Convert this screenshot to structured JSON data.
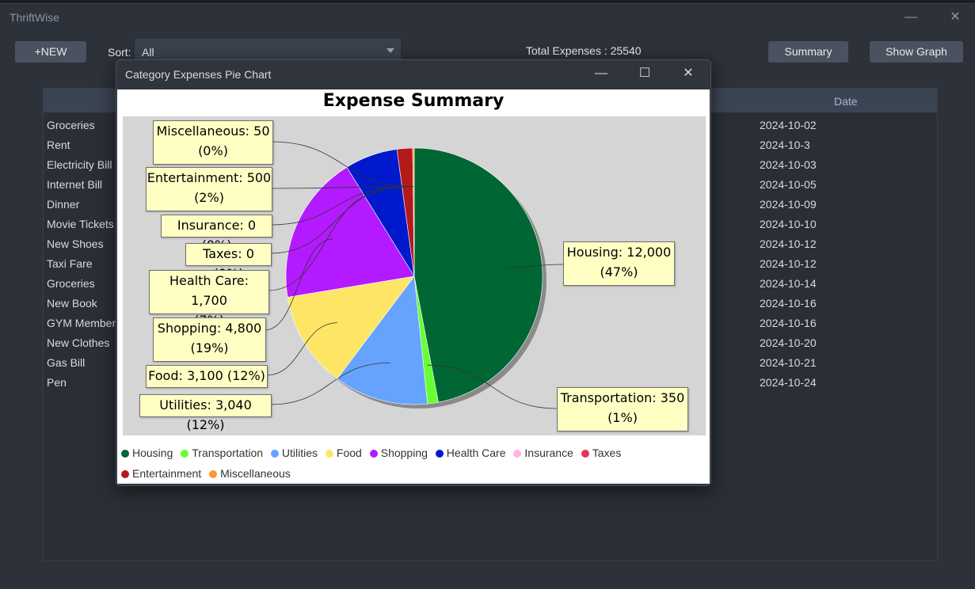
{
  "app": {
    "title": "ThriftWise",
    "buttons": {
      "new": "+NEW",
      "summary": "Summary",
      "show_graph": "Show Graph"
    },
    "sort": {
      "label": "Sort:",
      "value": "All"
    },
    "total": "Total Expenses : 25540",
    "table": {
      "date_header": "Date",
      "rows": [
        {
          "name": "Groceries",
          "date": "2024-10-02"
        },
        {
          "name": "Rent",
          "date": "2024-10-3"
        },
        {
          "name": "Electricity Bill",
          "date": "2024-10-03"
        },
        {
          "name": "Internet Bill",
          "date": "2024-10-05"
        },
        {
          "name": "Dinner",
          "date": "2024-10-09"
        },
        {
          "name": "Movie Tickets",
          "date": "2024-10-10"
        },
        {
          "name": "New Shoes",
          "date": "2024-10-12"
        },
        {
          "name": "Taxi Fare",
          "date": "2024-10-12"
        },
        {
          "name": "Groceries",
          "date": "2024-10-14"
        },
        {
          "name": "New Book",
          "date": "2024-10-16"
        },
        {
          "name": "GYM Member",
          "date": "2024-10-16"
        },
        {
          "name": "New Clothes",
          "date": "2024-10-20"
        },
        {
          "name": "Gas Bill",
          "date": "2024-10-21"
        },
        {
          "name": "Pen",
          "date": "2024-10-24"
        }
      ]
    }
  },
  "dialog": {
    "title": "Category Expenses Pie Chart"
  },
  "chart_data": {
    "type": "pie",
    "title": "Expense Summary",
    "slices": [
      {
        "name": "Housing",
        "value": 12000,
        "label": "Housing: 12,000",
        "pct": "(47%)",
        "color": "#006633"
      },
      {
        "name": "Transportation",
        "value": 350,
        "label": "Transportation: 350",
        "pct": "(1%)",
        "color": "#66ff33"
      },
      {
        "name": "Utilities",
        "value": 3040,
        "label": "Utilities: 3,040 (12%)",
        "pct": "",
        "color": "#66a3ff"
      },
      {
        "name": "Food",
        "value": 3100,
        "label": "Food: 3,100 (12%)",
        "pct": "",
        "color": "#ffe566"
      },
      {
        "name": "Shopping",
        "value": 4800,
        "label": "Shopping: 4,800",
        "pct": "(19%)",
        "color": "#b31aff"
      },
      {
        "name": "Health Care",
        "value": 1700,
        "label": "Health Care: 1,700",
        "pct": "(7%)",
        "color": "#0019cc"
      },
      {
        "name": "Insurance",
        "value": 0,
        "label": "Insurance: 0 (0%)",
        "pct": "",
        "color": "#ffb3e6"
      },
      {
        "name": "Taxes",
        "value": 0,
        "label": "Taxes: 0 (0%)",
        "pct": "",
        "color": "#e6335a"
      },
      {
        "name": "Entertainment",
        "value": 500,
        "label": "Entertainment: 500",
        "pct": "(2%)",
        "color": "#b31a1a"
      },
      {
        "name": "Miscellaneous",
        "value": 50,
        "label": "Miscellaneous: 50",
        "pct": "(0%)",
        "color": "#ff9933"
      }
    ],
    "legend_placement": "bottom"
  }
}
